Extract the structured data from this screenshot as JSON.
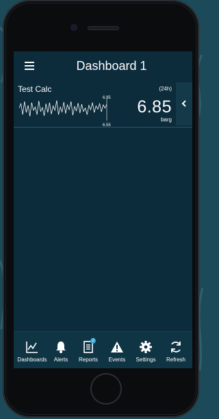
{
  "app": {
    "title": "Dashboard 1"
  },
  "tile": {
    "name": "Test Calc",
    "period": "(24h)",
    "value": "6.85",
    "unit": "barg",
    "spark_max": "6.95",
    "spark_min": "6.55"
  },
  "chart_data": {
    "type": "line",
    "title": "",
    "ylim": [
      6.55,
      6.95
    ],
    "x": [
      0,
      1,
      2,
      3,
      4,
      5,
      6,
      7,
      8,
      9,
      10,
      11,
      12,
      13,
      14,
      15,
      16,
      17,
      18,
      19,
      20,
      21,
      22,
      23,
      24,
      25,
      26,
      27,
      28,
      29,
      30,
      31,
      32,
      33,
      34,
      35,
      36,
      37,
      38,
      39,
      40,
      41,
      42,
      43,
      44,
      45,
      46,
      47,
      48,
      49
    ],
    "series": [
      {
        "values": [
          6.78,
          6.86,
          6.66,
          6.9,
          6.7,
          6.83,
          6.63,
          6.88,
          6.74,
          6.8,
          6.66,
          6.91,
          6.72,
          6.79,
          6.64,
          6.86,
          6.7,
          6.88,
          6.67,
          6.82,
          6.74,
          6.92,
          6.66,
          6.8,
          6.71,
          6.89,
          6.68,
          6.84,
          6.75,
          6.9,
          6.65,
          6.81,
          6.73,
          6.87,
          6.69,
          6.85,
          6.72,
          6.78,
          6.66,
          6.83,
          6.75,
          6.88,
          6.7,
          6.82,
          6.76,
          6.86,
          6.71,
          6.84,
          6.78,
          6.85
        ]
      }
    ]
  },
  "tabs": [
    {
      "label": "Dashboards",
      "icon": "chart-line-icon"
    },
    {
      "label": "Alerts",
      "icon": "bell-icon"
    },
    {
      "label": "Reports",
      "icon": "report-icon",
      "badge": "2"
    },
    {
      "label": "Events",
      "icon": "warning-icon"
    },
    {
      "label": "Settings",
      "icon": "gear-icon"
    },
    {
      "label": "Refresh",
      "icon": "refresh-icon"
    }
  ],
  "colors": {
    "screen_bg": "#0c2b3b",
    "tabbar_bg": "#0f3444",
    "accent": "#3aa6d2",
    "text": "#ffffff"
  }
}
